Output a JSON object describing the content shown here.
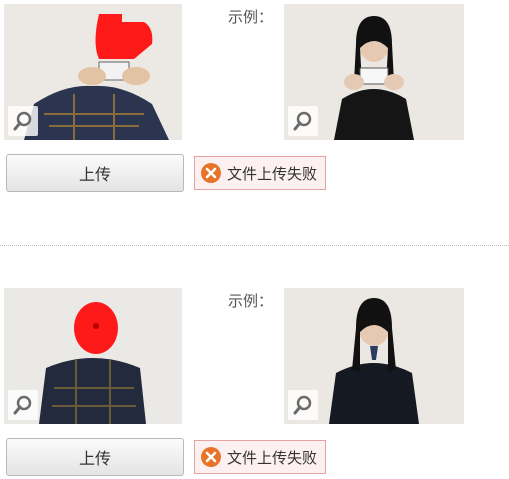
{
  "sections": [
    {
      "example_label": "示例：",
      "upload_label": "上传",
      "error_text": "文件上传失败"
    },
    {
      "example_label": "示例：",
      "upload_label": "上传",
      "error_text": "文件上传失败"
    }
  ],
  "icons": {
    "zoom": "magnifier-icon",
    "error": "error-x-icon"
  },
  "colors": {
    "error_icon": "#e8742a",
    "error_border": "#e6a3a3",
    "error_bg": "#fdf0f0",
    "redaction": "#ff1a1a"
  }
}
